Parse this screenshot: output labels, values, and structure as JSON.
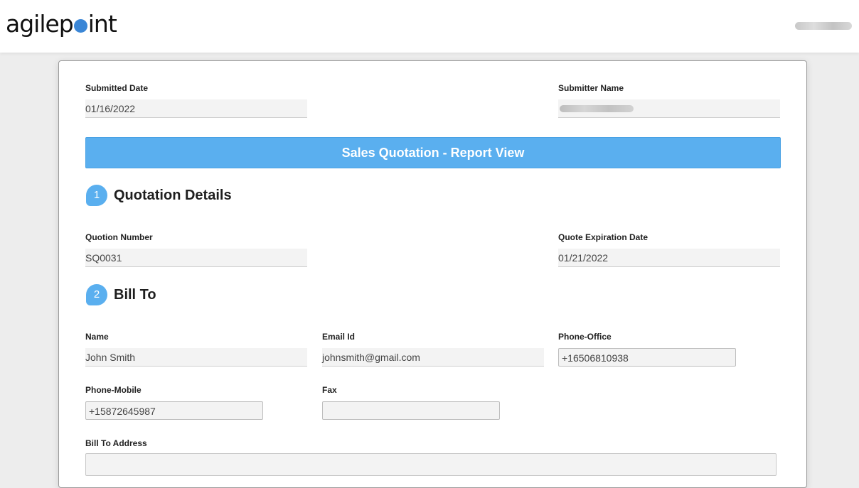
{
  "header": {
    "logo_text_left": "agilep",
    "logo_text_right": "int",
    "logo_dot_color": "#3a86d6"
  },
  "meta_fields": {
    "submitted_date": {
      "label": "Submitted Date",
      "value": "01/16/2022"
    },
    "submitter_name": {
      "label": "Submitter Name"
    }
  },
  "banner": {
    "title": "Sales Quotation - Report View",
    "color": "#5aafef"
  },
  "sections": {
    "quotation": {
      "number": "1",
      "title": "Quotation Details"
    },
    "bill_to": {
      "number": "2",
      "title": "Bill To"
    }
  },
  "quotation_fields": {
    "quote_number": {
      "label": "Quotion Number",
      "value": "SQ0031"
    },
    "expiration_date": {
      "label": "Quote Expiration Date",
      "value": "01/21/2022"
    }
  },
  "bill_to_fields": {
    "name": {
      "label": "Name",
      "value": "John Smith"
    },
    "email": {
      "label": "Email Id",
      "value": "johnsmith@gmail.com"
    },
    "phone_office": {
      "label": "Phone-Office",
      "value": "+16506810938"
    },
    "phone_mobile": {
      "label": "Phone-Mobile",
      "value": "+15872645987"
    },
    "fax": {
      "label": "Fax",
      "value": ""
    },
    "address": {
      "label": "Bill To Address"
    }
  }
}
